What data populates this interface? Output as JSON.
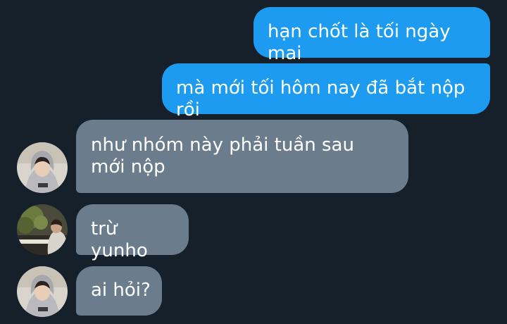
{
  "messages": [
    {
      "direction": "outgoing",
      "text": "hạn chốt là tối ngày mai"
    },
    {
      "direction": "outgoing",
      "text": "mà mới tối hôm nay đã bắt nộp rồi"
    },
    {
      "direction": "incoming",
      "text": "như nhóm này phải tuần sau mới nộp"
    },
    {
      "direction": "incoming",
      "text": "trừ yunho"
    },
    {
      "direction": "incoming",
      "text": "ai hỏi?"
    }
  ],
  "colors": {
    "background": "#15202b",
    "outgoing_bubble": "#1d9bf0",
    "incoming_bubble": "#6b7d8c",
    "text": "#ffffff"
  },
  "avatars": [
    {
      "icon": "hooded-person-photo"
    },
    {
      "icon": "person-at-piano-photo"
    },
    {
      "icon": "hooded-person-photo"
    }
  ]
}
